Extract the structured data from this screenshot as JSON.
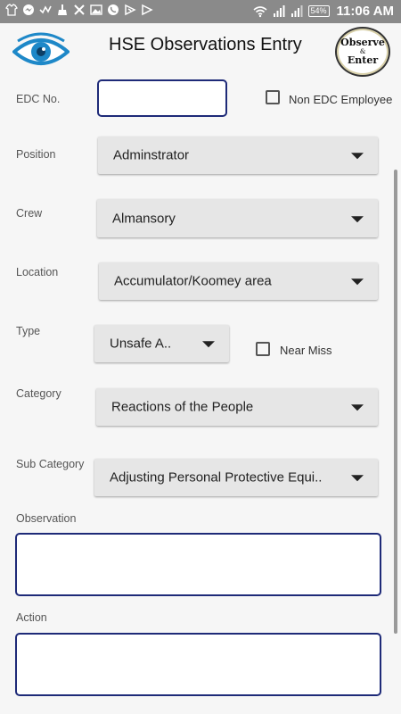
{
  "status_bar": {
    "battery": "54%",
    "time": "11:06 AM",
    "icons": [
      "tshirt-icon",
      "messenger-icon",
      "check-icon",
      "broom-icon",
      "x-icon",
      "image-icon",
      "whatsapp-icon",
      "play-store-icon",
      "play-icon",
      "wifi-icon",
      "signal-icon",
      "signal-icon"
    ]
  },
  "header": {
    "title": "HSE Observations Entry",
    "badge_top": "Observe",
    "badge_mid": "&",
    "badge_bottom": "Enter",
    "accent": "#1e88c8"
  },
  "form": {
    "edc_label": "EDC No.",
    "edc_value": "",
    "non_edc_label": "Non EDC Employee",
    "position_label": "Position",
    "position_value": "Adminstrator",
    "crew_label": "Crew",
    "crew_value": "Almansory",
    "location_label": "Location",
    "location_value": "Accumulator/Koomey area",
    "type_label": "Type",
    "type_value": "Unsafe A..",
    "near_miss_label": "Near Miss",
    "category_label": "Category",
    "category_value": "Reactions of the People",
    "subcategory_label": "Sub Category",
    "subcategory_value": "Adjusting Personal Protective Equi..",
    "observation_label": "Observation",
    "observation_value": "",
    "action_label": "Action",
    "action_value": ""
  },
  "colors": {
    "input_border": "#1e2a78",
    "dropdown_bg": "#e6e6e6",
    "status_bar_bg": "#8a8a8a"
  }
}
